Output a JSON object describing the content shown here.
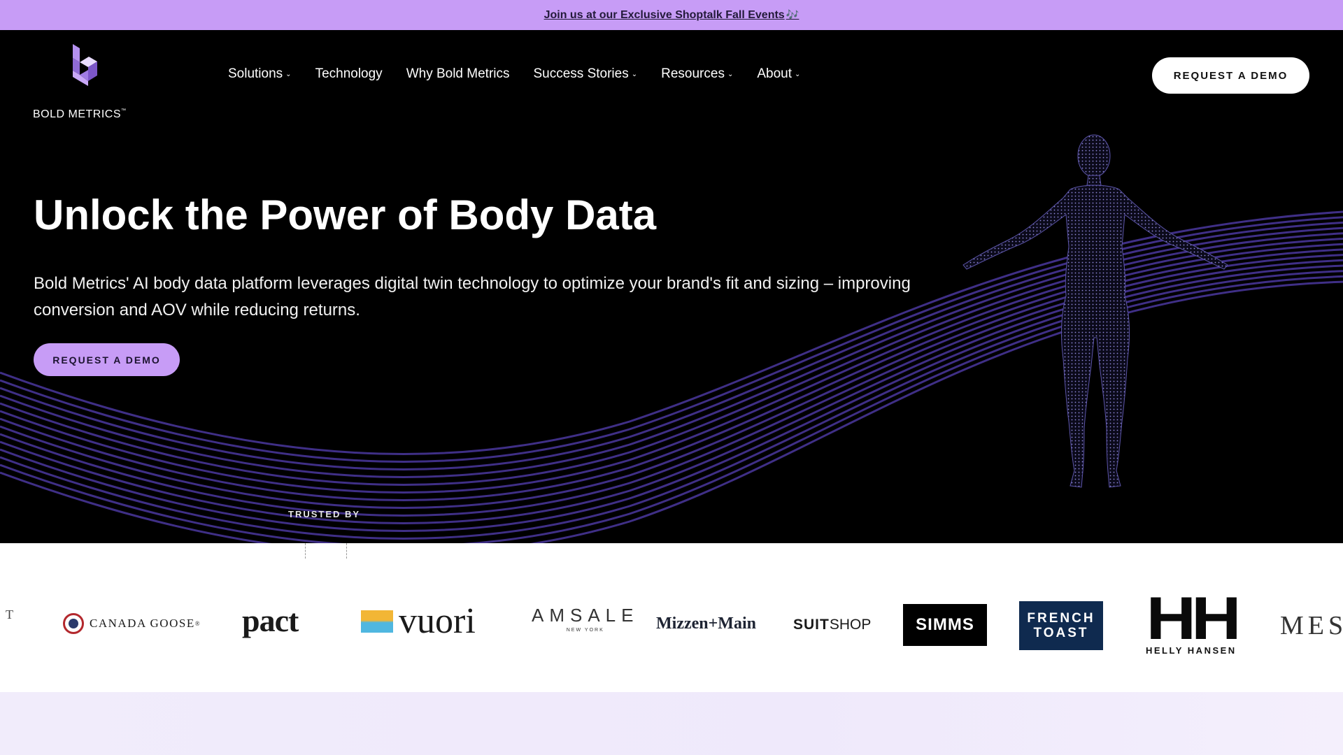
{
  "announcement": {
    "text": "Join us at our Exclusive Shoptalk Fall Events",
    "note_icon": "music-note-icon",
    "note_glyph": "🎶"
  },
  "header": {
    "logo_text": "BOLD METRICS",
    "logo_tm": "™",
    "nav": [
      {
        "label": "Solutions",
        "dropdown": true
      },
      {
        "label": "Technology",
        "dropdown": false
      },
      {
        "label": "Why Bold Metrics",
        "dropdown": false
      },
      {
        "label": "Success Stories",
        "dropdown": true
      },
      {
        "label": "Resources",
        "dropdown": true
      },
      {
        "label": "About",
        "dropdown": true
      }
    ],
    "cta_label": "REQUEST A DEMO"
  },
  "hero": {
    "title": "Unlock the Power of Body Data",
    "subtitle": "Bold Metrics' AI body data platform leverages digital twin technology to optimize your brand's fit and sizing – improving conversion and AOV while reducing returns.",
    "cta_label": "REQUEST A DEMO",
    "trusted_label": "TRUSTED BY"
  },
  "brands": {
    "partial_left": "T",
    "canada_goose": "CANADA GOOSE",
    "canada_goose_tm": "®",
    "pact": "pact",
    "vuori": "vuori",
    "amsale": "AMSALE",
    "amsale_sub": "NEW YORK",
    "mizzen": "Mizzen+Main",
    "suitshop_bold": "SUIT",
    "suitshop_light": "SHOP",
    "simms": "SIMMS",
    "french_toast_1": "FRENCH",
    "french_toast_2": "TOAST",
    "helly_mark": "HH",
    "helly_name": "HELLY HANSEN",
    "partial_right": "MES"
  },
  "colors": {
    "announce_bg": "#c79cf6",
    "accent": "#c79cf6",
    "wave": "#3f2f86",
    "background": "#000000"
  }
}
